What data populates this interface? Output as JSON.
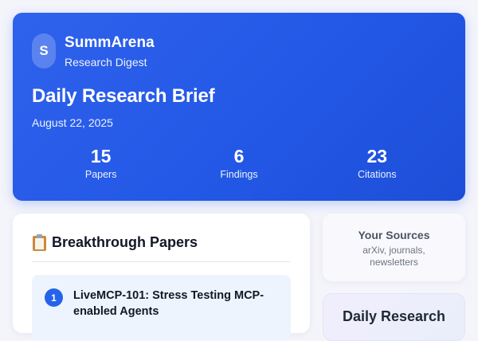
{
  "brand": {
    "logo_letter": "S",
    "name": "SummArena",
    "subtitle": "Research Digest"
  },
  "hero": {
    "title": "Daily Research Brief",
    "date": "August 22, 2025",
    "stats": [
      {
        "value": "15",
        "label": "Papers"
      },
      {
        "value": "6",
        "label": "Findings"
      },
      {
        "value": "23",
        "label": "Citations"
      }
    ]
  },
  "breakthrough": {
    "icon": "clipboard-icon",
    "heading": "Breakthrough Papers",
    "items": [
      {
        "number": "1",
        "title": "LiveMCP-101: Stress Testing MCP-enabled Agents"
      }
    ]
  },
  "sources": {
    "title": "Your Sources",
    "description": "arXiv, journals, newsletters"
  },
  "promo": {
    "title": "Daily Research"
  },
  "colors": {
    "hero_gradient_start": "#2f62ec",
    "hero_gradient_end": "#1d4ed8",
    "accent": "#2563eb",
    "paper_item_bg": "#eef4fd",
    "page_bg": "#f4f4fb"
  }
}
